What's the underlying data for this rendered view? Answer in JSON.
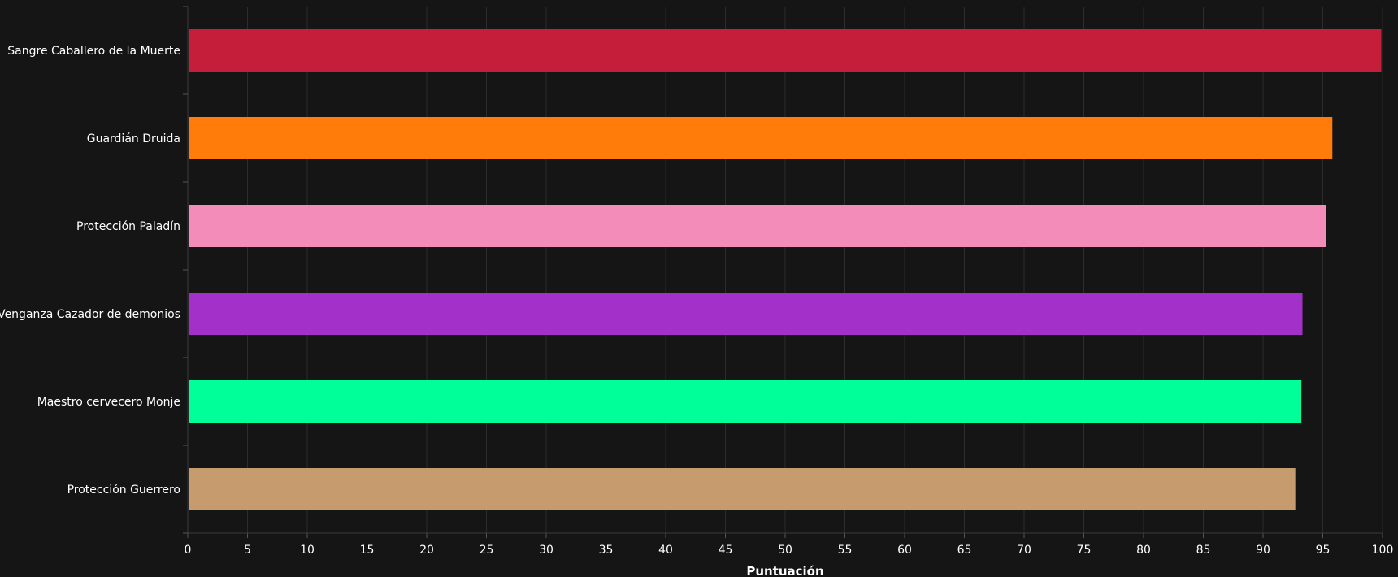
{
  "chart_data": {
    "type": "bar",
    "orientation": "horizontal",
    "categories": [
      "Sangre Caballero de la Muerte",
      "Guardián Druida",
      "Protección Paladín",
      "Venganza Cazador de demonios",
      "Maestro cervecero Monje",
      "Protección Guerrero"
    ],
    "values": [
      99.9,
      95.8,
      95.3,
      93.3,
      93.2,
      92.7
    ],
    "colors": [
      "#c41e3a",
      "#ff7c0a",
      "#f48cba",
      "#a330c9",
      "#00ff98",
      "#c69b6d"
    ],
    "xlabel": "Puntuación",
    "ylabel": "",
    "xlim": [
      0,
      100
    ],
    "xticks": [
      "0",
      "5",
      "10",
      "15",
      "20",
      "25",
      "30",
      "35",
      "40",
      "45",
      "50",
      "55",
      "60",
      "65",
      "70",
      "75",
      "80",
      "85",
      "90",
      "95",
      "100"
    ],
    "grid": "vertical"
  },
  "theme": {
    "background": "#151515",
    "text": "#ffffff",
    "grid": "#2c2c2c"
  }
}
